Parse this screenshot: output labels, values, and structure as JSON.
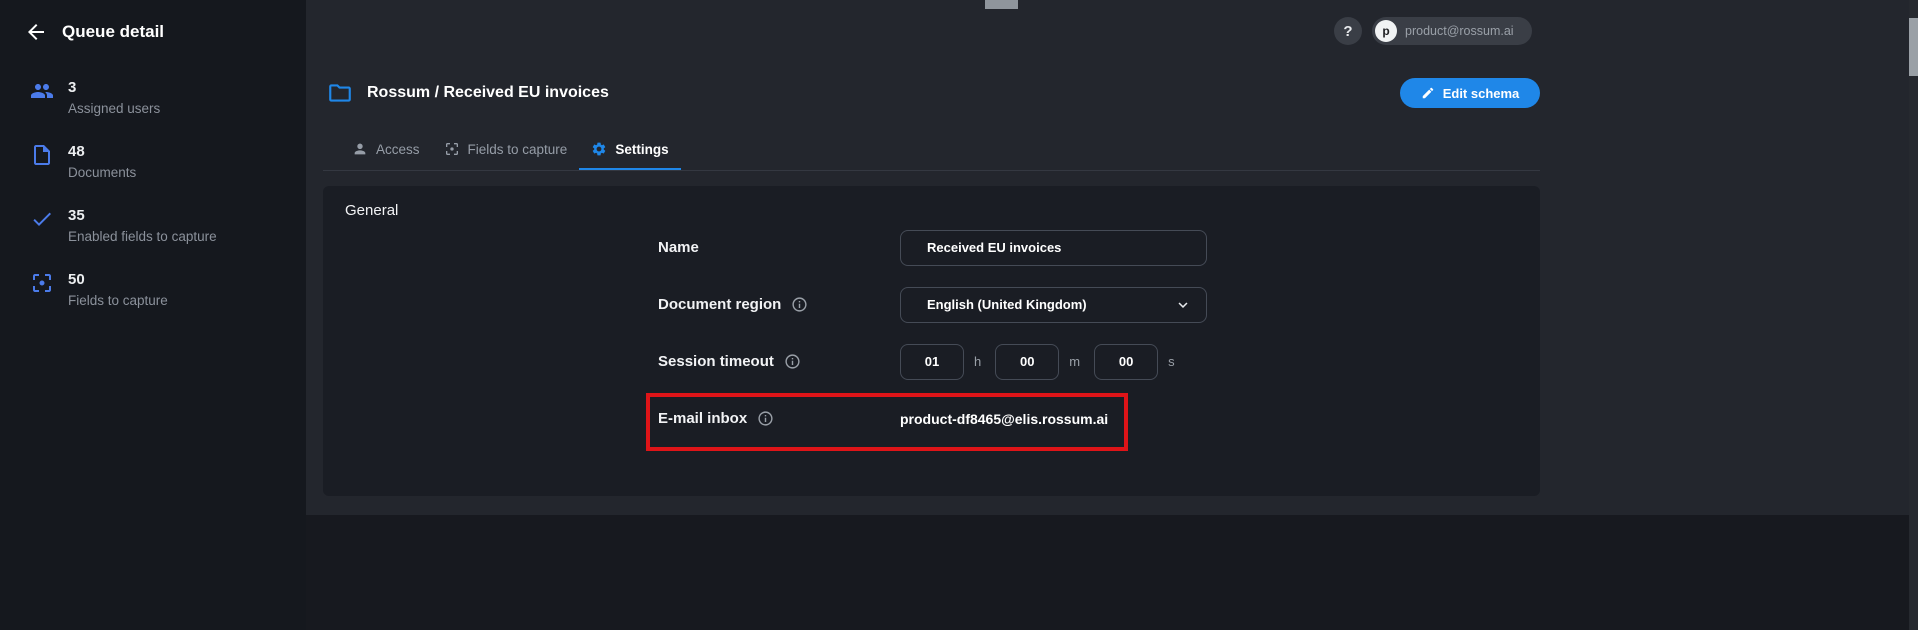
{
  "sidebar": {
    "title": "Queue detail",
    "stats": [
      {
        "value": "3",
        "label": "Assigned users",
        "icon": "assigned-users-icon"
      },
      {
        "value": "48",
        "label": "Documents",
        "icon": "documents-icon"
      },
      {
        "value": "35",
        "label": "Enabled fields to capture",
        "icon": "enabled-fields-icon"
      },
      {
        "value": "50",
        "label": "Fields to capture",
        "icon": "fields-to-capture-icon"
      }
    ]
  },
  "topbar": {
    "help_label": "?",
    "user": {
      "avatar_letter": "p",
      "email": "product@rossum.ai"
    }
  },
  "header": {
    "breadcrumb": "Rossum / Received EU invoices",
    "edit_schema_button": "Edit schema"
  },
  "tabs": [
    {
      "label": "Access"
    },
    {
      "label": "Fields to capture"
    },
    {
      "label": "Settings"
    }
  ],
  "panel": {
    "title": "General",
    "name_row": {
      "label": "Name",
      "value": "Received EU invoices"
    },
    "region_row": {
      "label": "Document region",
      "value": "English (United Kingdom)"
    },
    "timeout_row": {
      "label": "Session timeout",
      "hours": "01",
      "minutes": "00",
      "seconds": "00",
      "hours_unit": "h",
      "minutes_unit": "m",
      "seconds_unit": "s"
    },
    "inbox_row": {
      "label": "E-mail inbox",
      "value": "product-df8465@elis.rossum.ai"
    }
  },
  "colors": {
    "accent_blue": "#1f87e8",
    "annotation_red": "#df1418"
  }
}
